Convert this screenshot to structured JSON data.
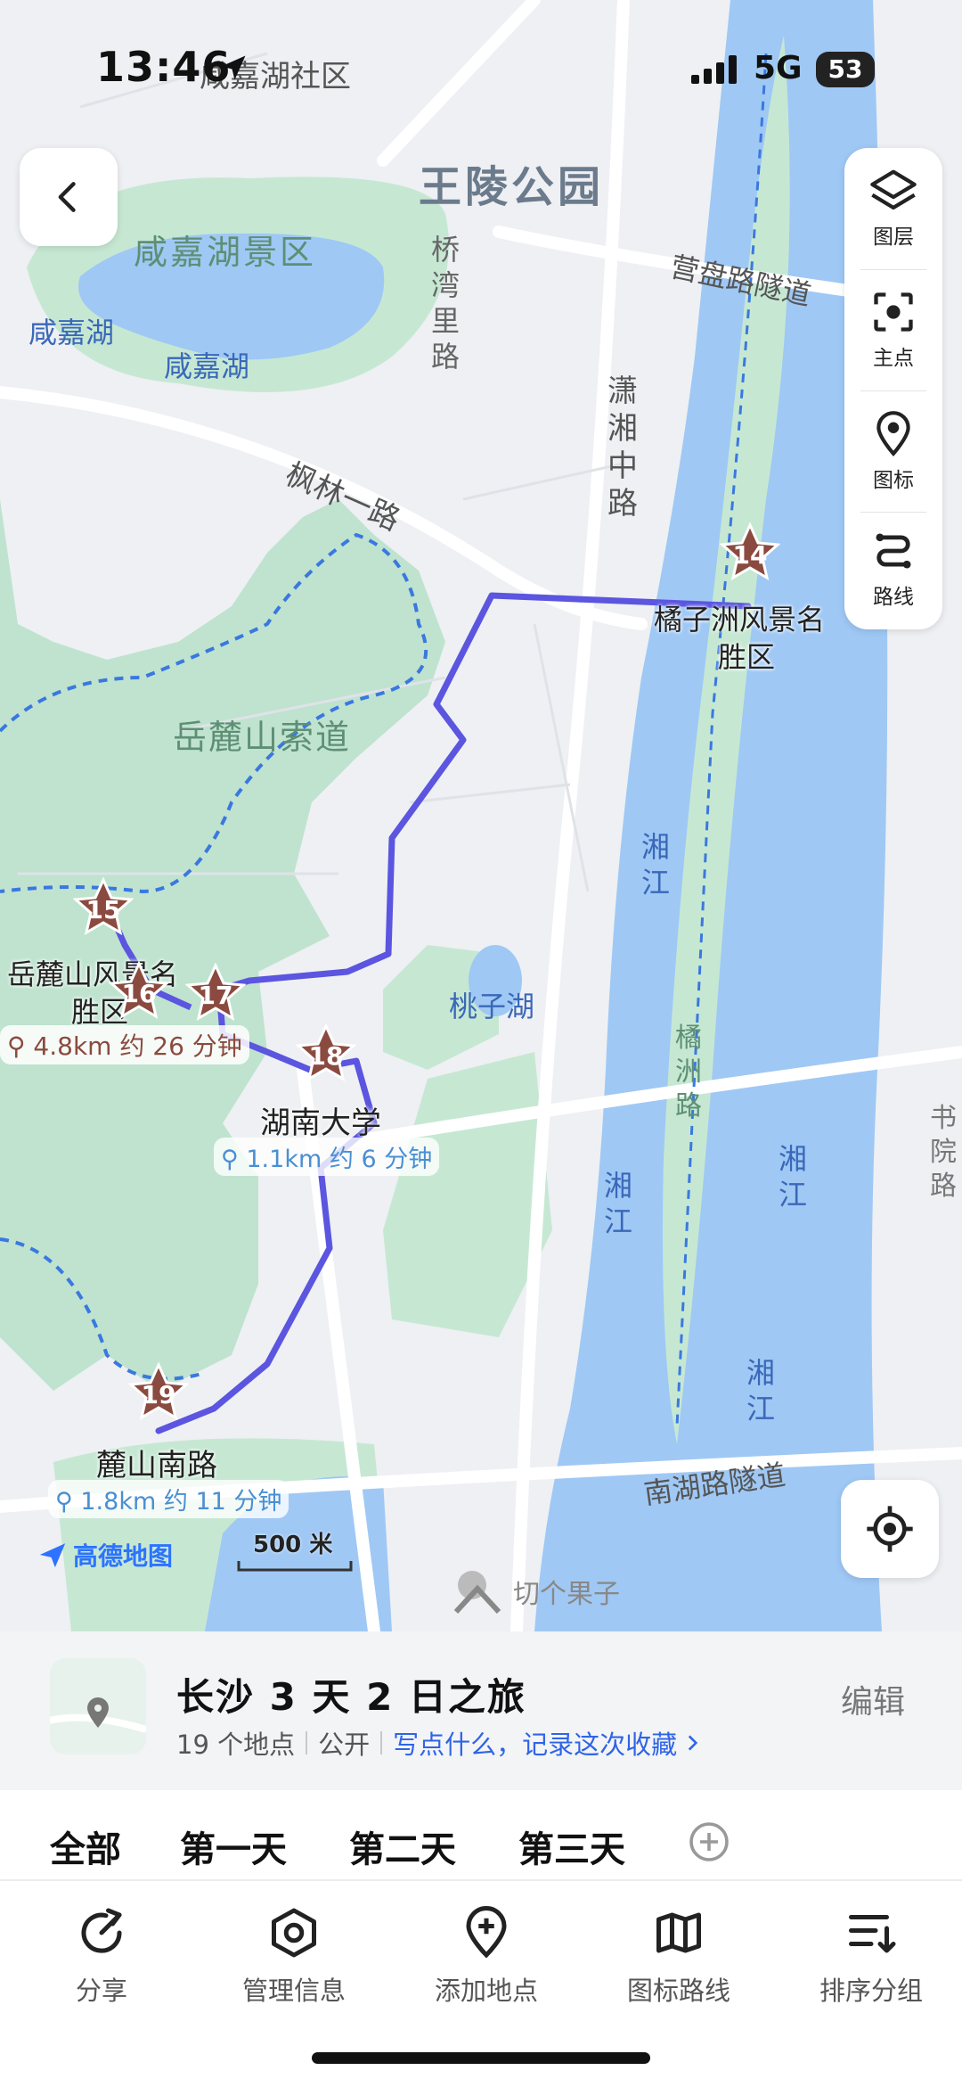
{
  "status_bar": {
    "time": "13:46",
    "network": "5G",
    "battery": "53"
  },
  "map": {
    "labels": {
      "xianjiahu_community": "咸嘉湖社区",
      "wangling_park": "王陵公园",
      "xianjiahu_scenic": "咸嘉湖景区",
      "xianjiahu_1": "咸嘉湖",
      "xianjiahu_2": "咸嘉湖",
      "qiaowanli_road": "桥湾里路",
      "yingpan_tunnel": "营盘路隧道",
      "xiaoxiang_middle_road": "潇湘中路",
      "fenglin_road": "枫林一路",
      "yuelu_cableway": "岳麓山索道",
      "xiangjiang_1": "湘江",
      "xiangjiang_2": "湘江",
      "xiangjiang_3": "湘江",
      "xiangjiang_4": "湘江",
      "taozi_lake": "桃子湖",
      "juzizhou_road": "橘洲路",
      "nanhu_tunnel": "南湖路隧道",
      "shuyuan_road": "书院路",
      "lushan_south_road": "麓山南路"
    },
    "pois": [
      {
        "num": "14",
        "name": "橘子洲风景名胜区"
      },
      {
        "num": "15",
        "name": "岳麓山风景名胜区"
      },
      {
        "num": "16",
        "name": ""
      },
      {
        "num": "17",
        "name": ""
      },
      {
        "num": "18",
        "name": "湖南大学"
      },
      {
        "num": "19",
        "name": "麓山南路"
      }
    ],
    "poi_labels": {
      "juzizhou_line1": "橘子洲风景名",
      "juzizhou_line2": "胜区",
      "yuelu_line1": "岳麓山风景名",
      "yuelu_line2": "胜区"
    },
    "route_segments": [
      {
        "distance": "4.8km",
        "duration": "约 26 分钟"
      },
      {
        "distance": "1.1km",
        "duration": "约 6 分钟"
      },
      {
        "distance": "1.8km",
        "duration": "约 11 分钟"
      }
    ],
    "route_color": "#5b55e0",
    "poi_color": "#8b4a3f",
    "scale": "500 米",
    "brand": "高德地图",
    "watermark": "切个果子"
  },
  "tools": [
    {
      "label": "图层",
      "icon": "layers-icon"
    },
    {
      "label": "主点",
      "icon": "focus-icon"
    },
    {
      "label": "图标",
      "icon": "pin-icon"
    },
    {
      "label": "路线",
      "icon": "route-icon"
    }
  ],
  "trip": {
    "title": "长沙 3 天 2 日之旅",
    "count": "19 个地点",
    "visibility": "公开",
    "note": "写点什么，记录这次收藏",
    "edit": "编辑"
  },
  "tabs": [
    "全部",
    "第一天",
    "第二天",
    "第三天"
  ],
  "toolbar": [
    {
      "label": "分享",
      "icon": "share-icon"
    },
    {
      "label": "管理信息",
      "icon": "manage-icon"
    },
    {
      "label": "添加地点",
      "icon": "add-place-icon"
    },
    {
      "label": "图标路线",
      "icon": "map-route-icon"
    },
    {
      "label": "排序分组",
      "icon": "sort-icon"
    }
  ]
}
